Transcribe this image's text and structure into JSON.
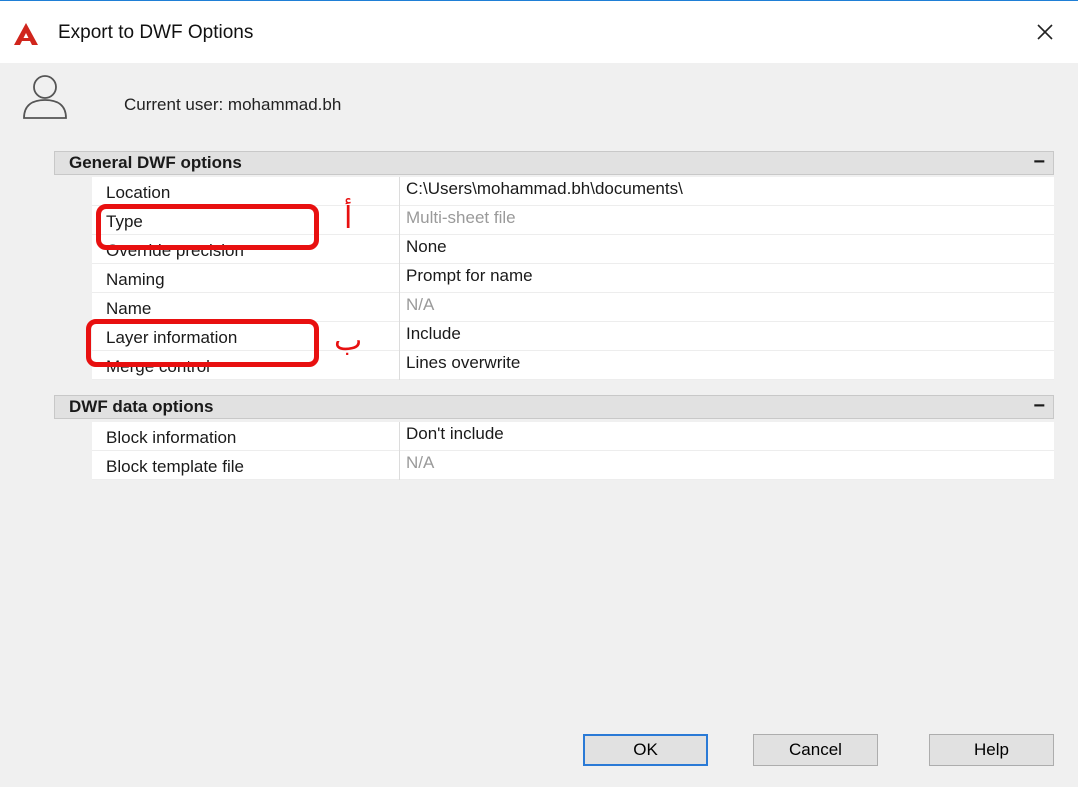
{
  "window": {
    "title": "Export to DWF Options",
    "close_icon": "close-icon",
    "app_icon": "autocad-logo-icon"
  },
  "user": {
    "label": "Current user: mohammad.bh",
    "icon": "user-icon"
  },
  "sections": [
    {
      "title": "General DWF options",
      "toggle": "−",
      "rows": [
        {
          "key": "Location",
          "value": "C:\\Users\\mohammad.bh\\documents\\",
          "disabled": false
        },
        {
          "key": "Type",
          "value": "Multi-sheet file",
          "disabled": true
        },
        {
          "key": "Override precision",
          "value": "None",
          "disabled": false
        },
        {
          "key": "Naming",
          "value": "Prompt for name",
          "disabled": false
        },
        {
          "key": "Name",
          "value": "N/A",
          "disabled": true
        },
        {
          "key": "Layer information",
          "value": "Include",
          "disabled": false
        },
        {
          "key": "Merge control",
          "value": "Lines overwrite",
          "disabled": false
        }
      ]
    },
    {
      "title": "DWF data options",
      "toggle": "−",
      "rows": [
        {
          "key": "Block information",
          "value": "Don't include",
          "disabled": false
        },
        {
          "key": "Block template file",
          "value": "N/A",
          "disabled": true
        }
      ]
    }
  ],
  "annotations": {
    "label_a": "أ",
    "label_b": "ب",
    "color": "#e81010"
  },
  "buttons": {
    "ok": "OK",
    "cancel": "Cancel",
    "help": "Help"
  },
  "colors": {
    "accent": "#2a7ad6",
    "disabled_text": "#9a9a9a"
  }
}
